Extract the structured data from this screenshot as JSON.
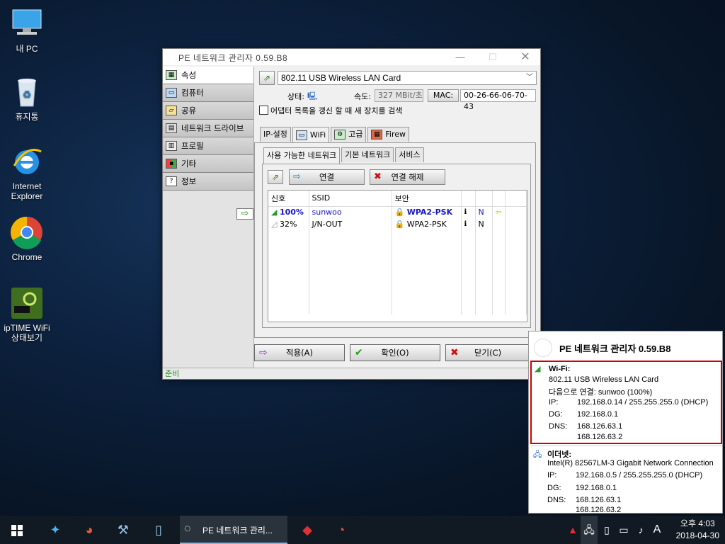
{
  "desktop": {
    "icons": [
      {
        "name": "mypc",
        "label": "내 PC"
      },
      {
        "name": "recycle",
        "label": "휴지통"
      },
      {
        "name": "ie",
        "label": "Internet Explorer"
      },
      {
        "name": "chrome",
        "label": "Chrome"
      },
      {
        "name": "iptime",
        "label": "ipTIME WiFi 상태보기"
      }
    ]
  },
  "window": {
    "title": "PE 네트워크 관리자 0.59.B8",
    "sidebar": [
      "속성",
      "컴퓨터",
      "공유",
      "네트워크 드라이브",
      "프로필",
      "기타",
      "정보"
    ],
    "adapter": "802.11 USB Wireless LAN Card",
    "status_label": "상태:",
    "speed_label": "속도:",
    "speed_value": "327 MBit/초",
    "mac_label": "MAC:",
    "mac_value": "00-26-66-06-70-43",
    "refresh_label": "어댑터 목록을 갱신 할 때 새 장치를 검색",
    "tabs": [
      "IP-설정",
      "WiFi",
      "고급",
      "Firew"
    ],
    "subtabs": [
      "사용 가능한 네트워크",
      "기본 네트워크",
      "서비스"
    ],
    "connect_label": "연결",
    "disconnect_label": "연결 해제",
    "columns": {
      "signal": "신호",
      "ssid": "SSID",
      "security": "보안"
    },
    "networks": [
      {
        "signal": "100%",
        "ssid": "sunwoo",
        "security": "WPA2-PSK",
        "mode": "N"
      },
      {
        "signal": "32%",
        "ssid": "J/N-OUT",
        "security": "WPA2-PSK",
        "mode": "N"
      }
    ],
    "apply_label": "적용(A)",
    "ok_label": "확인(O)",
    "close_label": "닫기(C)",
    "status_bar": "준비"
  },
  "popup": {
    "title": "PE 네트워크 관리자 0.59.B8",
    "wifi": {
      "header": "Wi-Fi:",
      "device": "802.11 USB Wireless LAN Card",
      "connected": "다음으로 연결: sunwoo (100%)",
      "ip_label": "IP:",
      "ip": "192.168.0.14   /   255.255.255.0 (DHCP)",
      "dg_label": "DG:",
      "dg": "192.168.0.1",
      "dns_label": "DNS:",
      "dns1": "168.126.63.1",
      "dns2": "168.126.63.2"
    },
    "ethernet": {
      "header": "이더넷:",
      "device": "Intel(R) 82567LM-3 Gigabit Network Connection",
      "ip_label": "IP:",
      "ip": "192.168.0.5   /   255.255.255.0 (DHCP)",
      "dg_label": "DG:",
      "dg": "192.168.0.1",
      "dns_label": "DNS:",
      "dns1": "168.126.63.1",
      "dns2": "168.126.63.2"
    }
  },
  "taskbar": {
    "active_label": "PE 네트워크 관리...",
    "ime": "A",
    "time": "오후 4:03",
    "date": "2018-04-30"
  },
  "colors": {
    "accent_blue": "#1616c8",
    "highlight_red": "#d00000",
    "status_green": "#2a8b2a"
  }
}
